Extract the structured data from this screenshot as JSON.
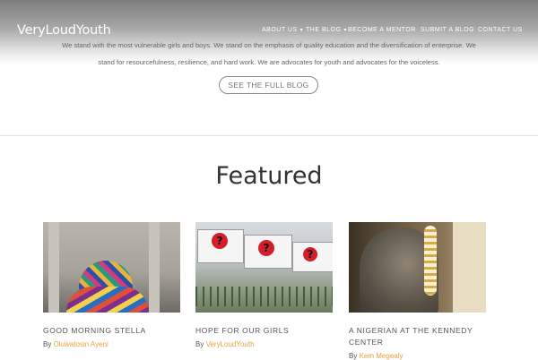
{
  "site": {
    "logo": "VeryLoudYouth"
  },
  "nav": {
    "items": [
      {
        "label": "ABOUT US",
        "has_dropdown": true
      },
      {
        "label": "THE BLOG",
        "has_dropdown": true
      },
      {
        "label": "BECOME A MENTOR",
        "has_dropdown": false
      },
      {
        "label": "SUBMIT A BLOG",
        "has_dropdown": false
      },
      {
        "label": "CONTACT US",
        "has_dropdown": false
      }
    ],
    "dropdown_glyph": "▾"
  },
  "intro": {
    "line1": "We stand with the most vulnerable girls and boys. We stand on the emphasis of quality education and the diversification of enterprise. We",
    "line2": "stand for resourcefulness, resilience, and hard work. We are advocates for youth and advocates for the voiceless."
  },
  "cta": {
    "label": "SEE THE FULL BLOG"
  },
  "featured": {
    "heading": "Featured",
    "posts": [
      {
        "title": "GOOD MORNING STELLA",
        "by": "By",
        "author": "Oluwatosin Ayeni"
      },
      {
        "title": "HOPE FOR OUR GIRLS",
        "by": "By",
        "author": "VeryLoudYouth"
      },
      {
        "title": "A NIGERIAN AT THE KENNEDY CENTER",
        "by": "By",
        "author": "Kem Megealy"
      }
    ]
  },
  "colors": {
    "accent": "#e8a23c",
    "heading": "#333333",
    "text": "#555555"
  }
}
